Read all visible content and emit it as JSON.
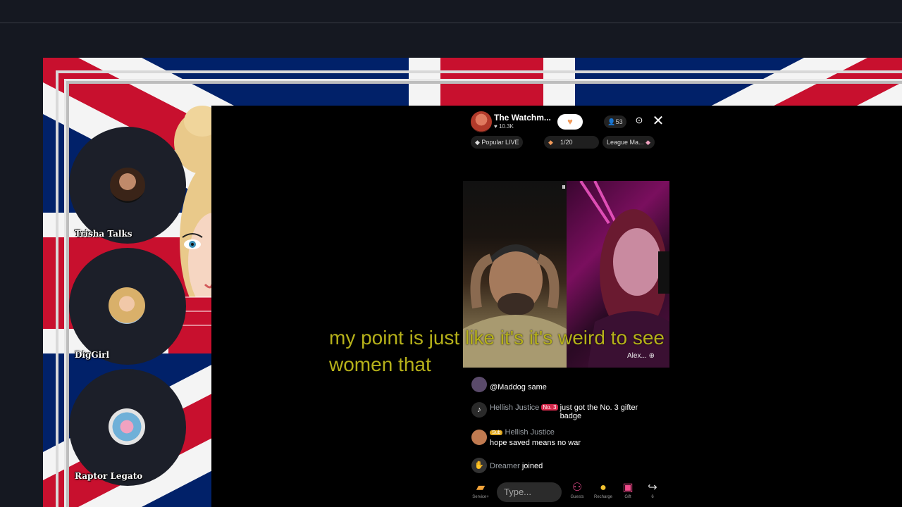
{
  "host": {
    "name": "The Watchm...",
    "likes": "10.3K",
    "follow_icon": "heart-icon"
  },
  "viewers": "53",
  "chips": {
    "popular": "Popular LIVE",
    "rank": "1/20",
    "league": "League Ma..."
  },
  "guests": [
    {
      "name": "Trisha Talks"
    },
    {
      "name": "DigGirl"
    },
    {
      "name": "Raptor Legato"
    }
  ],
  "video": {
    "right_label": "Alex..."
  },
  "caption": "my point is just like it's it's weird to see women that",
  "chat": [
    {
      "name": "",
      "message": "@Maddog same"
    },
    {
      "name": "Hellish Justice",
      "badge": "No. 3",
      "message": "just got the No. 3 gifter badge"
    },
    {
      "name": "Hellish Justice",
      "badge": "Sub",
      "message": "hope saved means no war"
    },
    {
      "name": "Dreamer",
      "message": "joined"
    }
  ],
  "bottom": {
    "input_placeholder": "Type...",
    "buttons": [
      "Service+",
      "Guests",
      "Recharge",
      "Gift",
      "6"
    ]
  },
  "colors": {
    "caption": "#b6b11a",
    "flag_red": "#c8102e",
    "flag_blue": "#012169",
    "accent": "#d6284b"
  }
}
